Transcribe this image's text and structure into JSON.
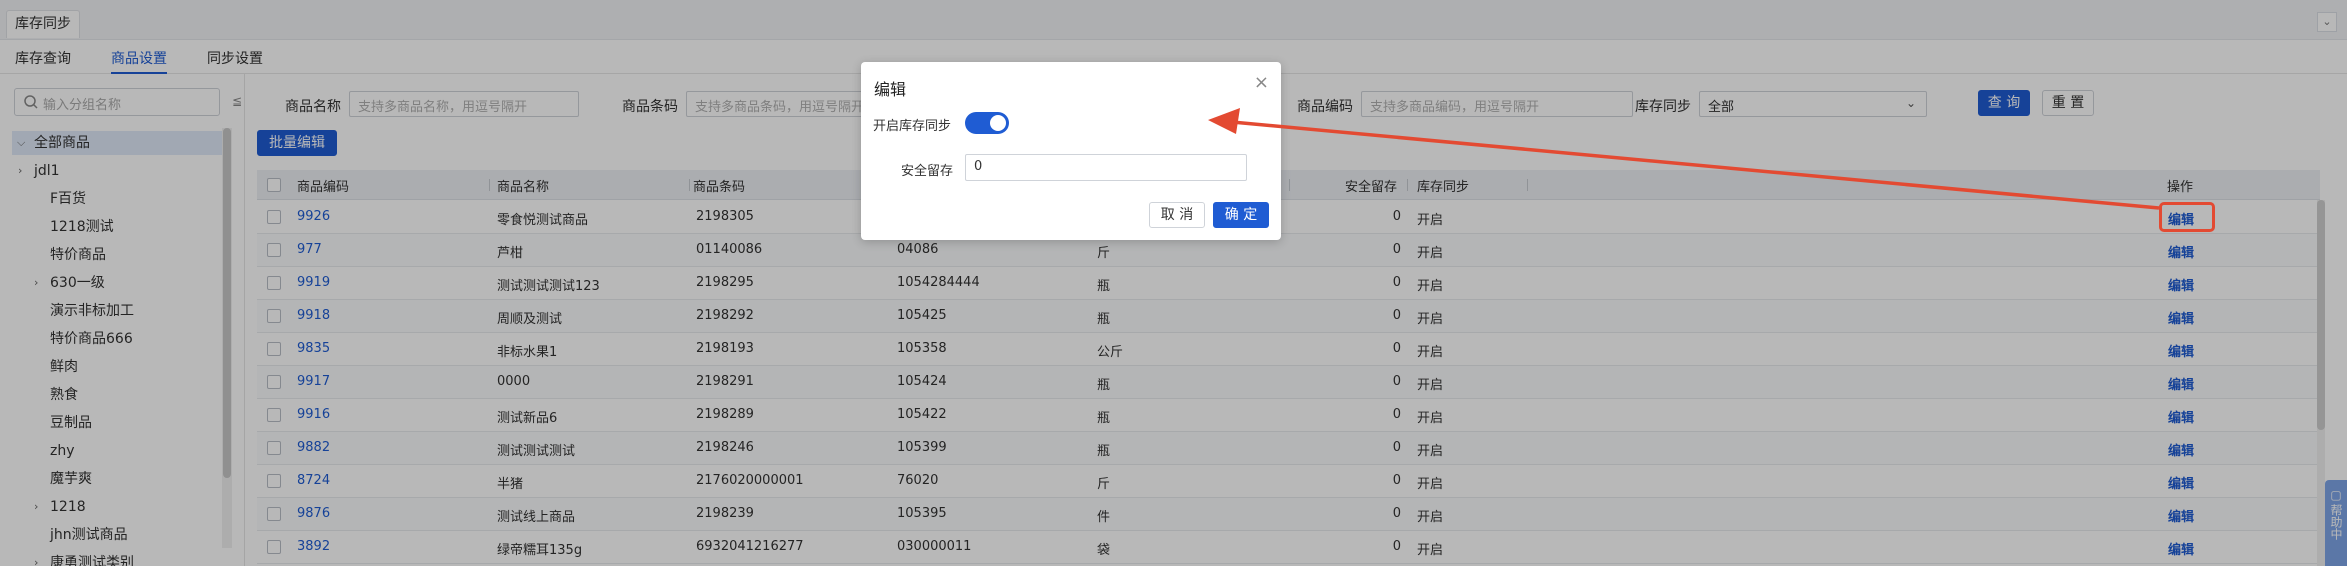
{
  "window": {
    "title": "库存同步"
  },
  "tabs": [
    {
      "label": "库存查询",
      "active": false
    },
    {
      "label": "商品设置",
      "active": true
    },
    {
      "label": "同步设置",
      "active": false
    }
  ],
  "tree": {
    "search_placeholder": "输入分组名称",
    "collapse_glyph": "≦",
    "root": "全部商品",
    "items": [
      "jdl1",
      "F百货",
      "1218测试",
      "特价商品",
      "630一级",
      "演示非标加工",
      "特价商品666",
      "鲜肉",
      "熟食",
      "豆制品",
      "zhy",
      "魔芋爽",
      "1218",
      "jhn测试商品",
      "康勇测试类别"
    ]
  },
  "filters": {
    "name_label": "商品名称",
    "name_placeholder": "支持多商品名称，用逗号隔开",
    "barcode_label": "商品条码",
    "barcode_placeholder": "支持多商品条码，用逗号隔开",
    "code_label": "商品编码",
    "code_placeholder": "支持多商品编码，用逗号隔开",
    "sync_label": "库存同步",
    "sync_value": "全部",
    "search_button": "查 询",
    "reset_button": "重 置"
  },
  "toolbar": {
    "bulk_edit": "批量编辑"
  },
  "table": {
    "headers": {
      "code": "商品编码",
      "name": "商品名称",
      "barcode": "商品条码",
      "safe_stock": "安全留存",
      "sync": "库存同步",
      "action": "操作"
    },
    "edit_label": "编辑",
    "rows": [
      {
        "code": "9926",
        "name": "零食悦测试商品",
        "barcode": "2198305",
        "sku": "",
        "unit": "",
        "safe": "0",
        "sync": "开启"
      },
      {
        "code": "977",
        "name": "芦柑",
        "barcode": "01140086",
        "sku": "04086",
        "unit": "斤",
        "safe": "0",
        "sync": "开启"
      },
      {
        "code": "9919",
        "name": "测试测试测试123",
        "barcode": "2198295",
        "sku": "1054284444",
        "unit": "瓶",
        "safe": "0",
        "sync": "开启"
      },
      {
        "code": "9918",
        "name": "周顺及测试",
        "barcode": "2198292",
        "sku": "105425",
        "unit": "瓶",
        "safe": "0",
        "sync": "开启"
      },
      {
        "code": "9835",
        "name": "非标水果1",
        "barcode": "2198193",
        "sku": "105358",
        "unit": "公斤",
        "safe": "0",
        "sync": "开启"
      },
      {
        "code": "9917",
        "name": "0000",
        "barcode": "2198291",
        "sku": "105424",
        "unit": "瓶",
        "safe": "0",
        "sync": "开启"
      },
      {
        "code": "9916",
        "name": "测试新品6",
        "barcode": "2198289",
        "sku": "105422",
        "unit": "瓶",
        "safe": "0",
        "sync": "开启"
      },
      {
        "code": "9882",
        "name": "测试测试测试",
        "barcode": "2198246",
        "sku": "105399",
        "unit": "瓶",
        "safe": "0",
        "sync": "开启"
      },
      {
        "code": "8724",
        "name": "半猪",
        "barcode": "2176020000001",
        "sku": "76020",
        "unit": "斤",
        "safe": "0",
        "sync": "开启"
      },
      {
        "code": "9876",
        "name": "测试线上商品",
        "barcode": "2198239",
        "sku": "105395",
        "unit": "件",
        "safe": "0",
        "sync": "开启"
      },
      {
        "code": "3892",
        "name": "绿帝糯耳135g",
        "barcode": "6932041216277",
        "sku": "030000011",
        "unit": "袋",
        "safe": "0",
        "sync": "开启"
      }
    ]
  },
  "modal": {
    "title": "编辑",
    "toggle_label": "开启库存同步",
    "toggle_on": true,
    "safe_label": "安全留存",
    "safe_value": "0",
    "cancel": "取 消",
    "confirm": "确 定"
  },
  "help": {
    "label": "帮助中"
  },
  "colors": {
    "primary": "#1f5cd3",
    "annotation": "#e34a32"
  }
}
